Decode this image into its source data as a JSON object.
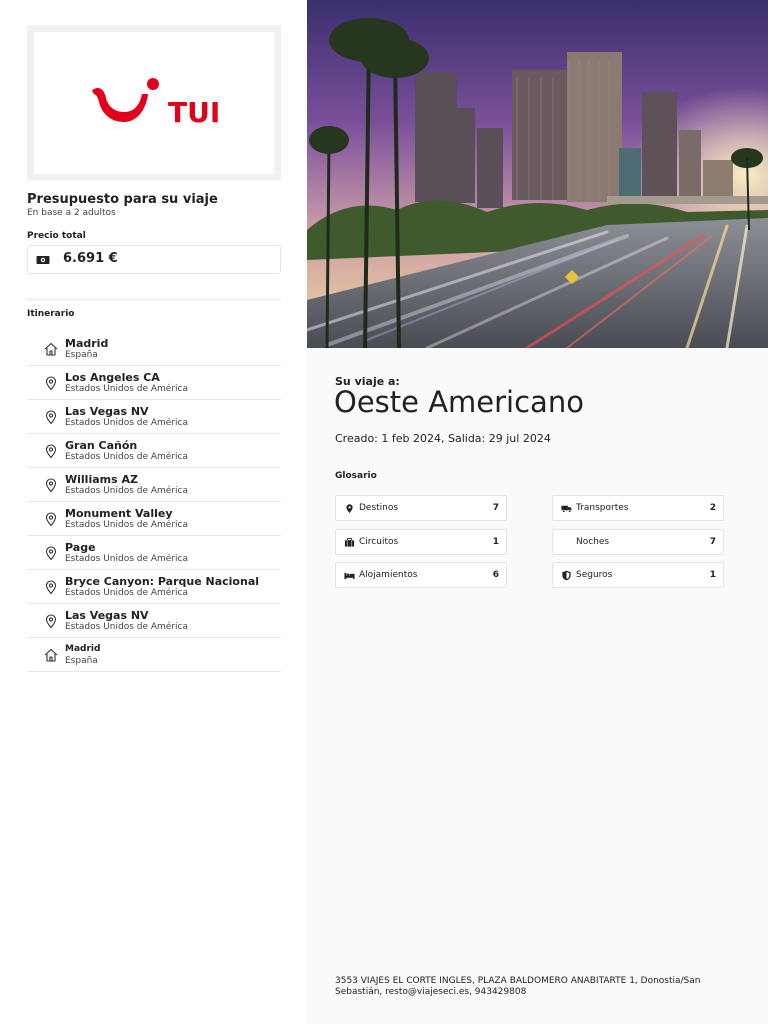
{
  "brand": {
    "name": "TUI",
    "color": "#e2001a"
  },
  "quote": {
    "title": "Presupuesto para su viaje",
    "subtitle": "En base a 2 adultos",
    "price_label": "Precio total",
    "price_value": "6.691 €"
  },
  "itinerary": {
    "label": "Itinerario",
    "items": [
      {
        "name": "Madrid",
        "country": "España",
        "icon": "home-icon"
      },
      {
        "name": "Los Angeles CA",
        "country": "Estados Unidos de América",
        "icon": "location-pin-icon"
      },
      {
        "name": "Las Vegas NV",
        "country": "Estados Unidos de América",
        "icon": "location-pin-icon"
      },
      {
        "name": "Gran Cañón",
        "country": "Estados Unidos de América",
        "icon": "location-pin-icon"
      },
      {
        "name": "Williams AZ",
        "country": "Estados Unidos de América",
        "icon": "location-pin-icon"
      },
      {
        "name": "Monument Valley",
        "country": "Estados Unidos de América",
        "icon": "location-pin-icon"
      },
      {
        "name": "Page",
        "country": "Estados Unidos de América",
        "icon": "location-pin-icon"
      },
      {
        "name": "Bryce Canyon: Parque Nacional",
        "country": "Estados Unidos de América",
        "icon": "location-pin-icon"
      },
      {
        "name": "Las Vegas NV",
        "country": "Estados Unidos de América",
        "icon": "location-pin-icon"
      },
      {
        "name": "Madrid",
        "country": "España",
        "icon": "home-icon"
      }
    ]
  },
  "trip": {
    "pre_title": "Su viaje a:",
    "title": "Oeste Americano",
    "dates": "Creado: 1 feb 2024, Salida: 29 jul 2024"
  },
  "glossary": {
    "label": "Glosario",
    "items": [
      {
        "name": "Destinos",
        "count": "7",
        "icon": "location-pin-icon"
      },
      {
        "name": "Transportes",
        "count": "2",
        "icon": "truck-icon"
      },
      {
        "name": "Circuitos",
        "count": "1",
        "icon": "luggage-icon"
      },
      {
        "name": "Noches",
        "count": "7",
        "icon": "moon-icon"
      },
      {
        "name": "Alojamientos",
        "count": "6",
        "icon": "bed-icon"
      },
      {
        "name": "Seguros",
        "count": "1",
        "icon": "shield-icon"
      }
    ]
  },
  "footer": {
    "text": "3553 VIAJES EL CORTE INGLES, PLAZA BALDOMERO ANABITARTE 1, Donostia/San Sebastián, resto@viajeseci.es, 943429808"
  }
}
